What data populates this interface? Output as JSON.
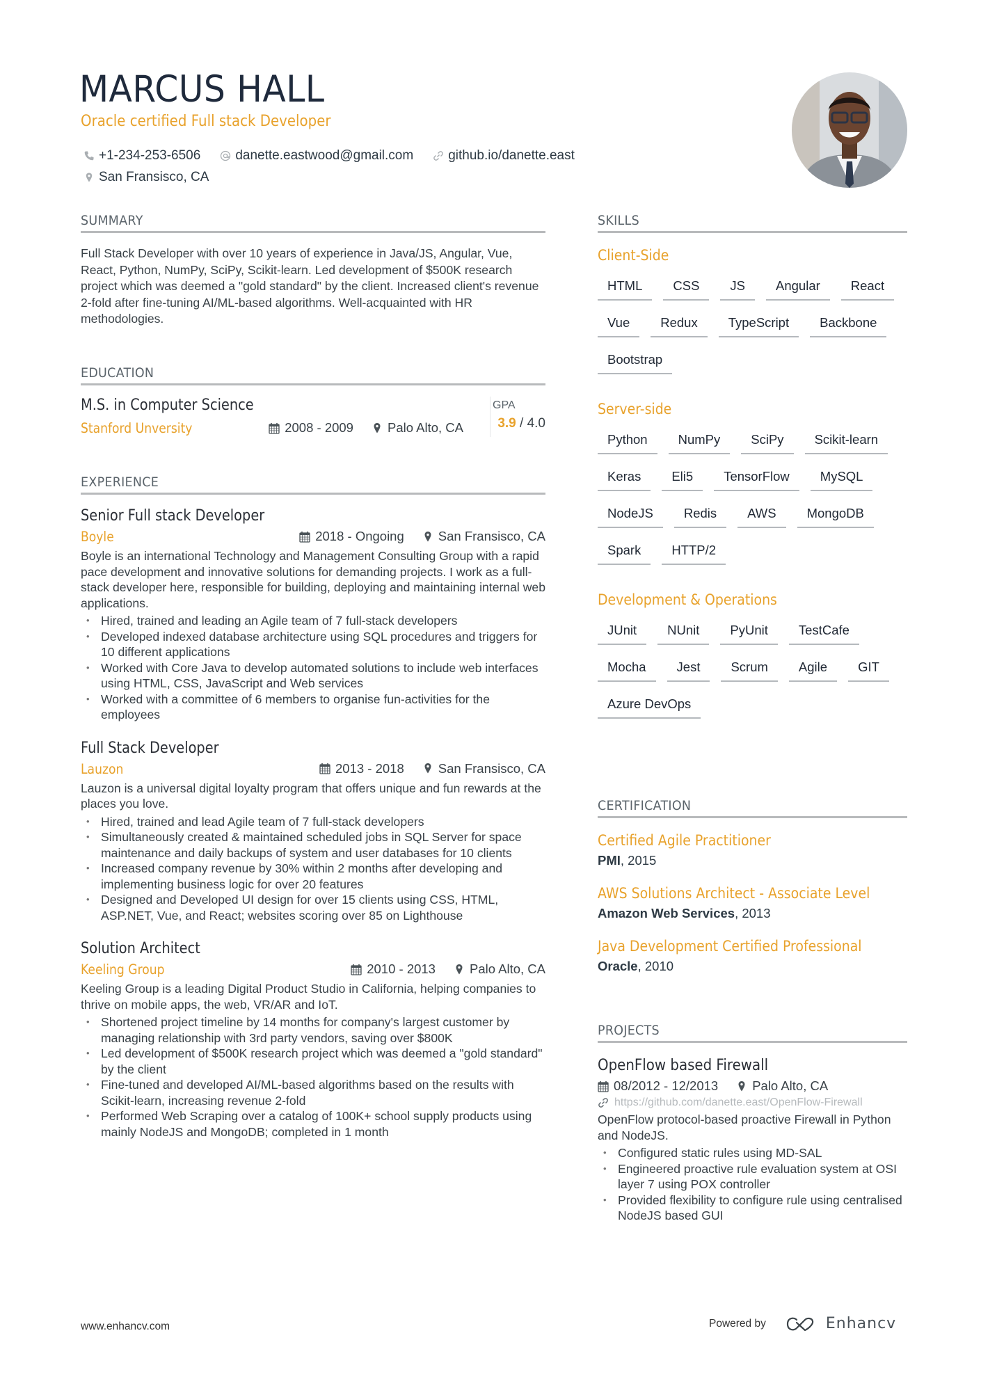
{
  "header": {
    "name": "MARCUS HALL",
    "title": "Oracle certified Full stack Developer",
    "phone": "+1-234-253-6506",
    "email": "danette.eastwood@gmail.com",
    "website": "github.io/danette.east",
    "location": "San Fransisco, CA",
    "photo_alt": "Profile photo"
  },
  "summary": {
    "heading": "SUMMARY",
    "text": "Full Stack Developer with over 10 years of experience in Java/JS, Angular, Vue, React, Python, NumPy, SciPy, Scikit-learn. Led development of $500K research project which was deemed a \"gold standard\" by the client. Increased client's revenue 2-fold after fine-tuning AI/ML-based algorithms. Well-acquainted with HR methodologies."
  },
  "education": {
    "heading": "EDUCATION",
    "degree": "M.S. in Computer Science",
    "school": "Stanford Unversity",
    "dates": "2008 - 2009",
    "location": "Palo Alto, CA",
    "gpa_label": "GPA",
    "gpa_value": "3.9",
    "gpa_max": "/ 4.0"
  },
  "experience": {
    "heading": "EXPERIENCE",
    "jobs": [
      {
        "title": "Senior Full stack Developer",
        "company": "Boyle",
        "dates": "2018 - Ongoing",
        "location": "San Fransisco, CA",
        "description": "Boyle is an international Technology and Management Consulting Group with a rapid pace development and innovative solutions for demanding projects. I work as a full-stack developer here, responsible for building, deploying and maintaining internal web applications.",
        "bullets": [
          "Hired, trained and leading an Agile team of 7 full-stack developers",
          "Developed indexed database architecture using SQL procedures and triggers for 10 different applications",
          "Worked with Core Java to develop automated solutions to include web interfaces using HTML, CSS, JavaScript and Web services",
          "Worked with a committee of 6 members to organise fun-activities for the employees"
        ]
      },
      {
        "title": "Full Stack Developer",
        "company": "Lauzon",
        "dates": "2013 - 2018",
        "location": "San Fransisco, CA",
        "description": "Lauzon is a universal digital loyalty program that offers unique and fun rewards at the places you love.",
        "bullets": [
          "Hired, trained and lead Agile team of 7 full-stack developers",
          "Simultaneously created & maintained scheduled jobs in SQL Server for space maintenance and daily backups of system and user databases for 10 clients",
          "Increased company revenue by 30% within 2 months after developing and implementing business logic for over 20 features",
          "Designed and Developed UI design for over 15 clients using CSS, HTML, ASP.NET, Vue, and React; websites scoring over 85 on Lighthouse"
        ]
      },
      {
        "title": "Solution Architect",
        "company": "Keeling Group",
        "dates": "2010 - 2013",
        "location": "Palo Alto, CA",
        "description": "Keeling Group is a leading Digital Product Studio in California, helping companies to thrive on mobile apps, the web, VR/AR and IoT.",
        "bullets": [
          "Shortened project timeline by 14 months for company's largest customer by managing relationship with 3rd party vendors, saving over $800K",
          "Led development of $500K research project which was deemed a \"gold standard\" by the client",
          "Fine-tuned and developed AI/ML-based algorithms based on the results with Scikit-learn, increasing revenue 2-fold",
          "Performed Web Scraping over a catalog of 100K+ school supply products using mainly NodeJS and MongoDB; completed in 1 month"
        ]
      }
    ]
  },
  "skills": {
    "heading": "SKILLS",
    "categories": [
      {
        "name": "Client-Side",
        "items": [
          "HTML",
          "CSS",
          "JS",
          "Angular",
          "React",
          "Vue",
          "Redux",
          "TypeScript",
          "Backbone",
          "Bootstrap"
        ]
      },
      {
        "name": "Server-side",
        "items": [
          "Python",
          "NumPy",
          "SciPy",
          "Scikit-learn",
          "Keras",
          "Eli5",
          "TensorFlow",
          "MySQL",
          "NodeJS",
          "Redis",
          "AWS",
          "MongoDB",
          "Spark",
          "HTTP/2"
        ]
      },
      {
        "name": "Development & Operations",
        "items": [
          "JUnit",
          "NUnit",
          "PyUnit",
          "TestCafe",
          "Mocha",
          "Jest",
          "Scrum",
          "Agile",
          "GIT",
          "Azure DevOps"
        ]
      }
    ]
  },
  "certification": {
    "heading": "CERTIFICATION",
    "items": [
      {
        "title": "Certified Agile Practitioner",
        "issuer": "PMI",
        "year": ", 2015"
      },
      {
        "title": "AWS Solutions Architect - Associate Level",
        "issuer": "Amazon Web Services",
        "year": ", 2013"
      },
      {
        "title": "Java Development Certified Professional",
        "issuer": "Oracle",
        "year": ", 2010"
      }
    ]
  },
  "projects": {
    "heading": "PROJECTS",
    "items": [
      {
        "title": "OpenFlow based Firewall",
        "dates": "08/2012 - 12/2013",
        "location": "Palo Alto, CA",
        "link": "https://github.com/danette.east/OpenFlow-Firewall",
        "description": "OpenFlow protocol-based proactive Firewall in Python and NodeJS.",
        "bullets": [
          "Configured static rules using MD-SAL",
          "Engineered proactive rule evaluation system at OSI layer 7 using POX controller",
          "Provided flexibility to configure rule using centralised NodeJS based GUI"
        ]
      }
    ]
  },
  "footer": {
    "website": "www.enhancv.com",
    "powered_by": "Powered by",
    "brand": "Enhancv"
  },
  "colors": {
    "accent": "#e8a22c",
    "heading": "#1f2a3c",
    "rule": "#b8babc"
  }
}
